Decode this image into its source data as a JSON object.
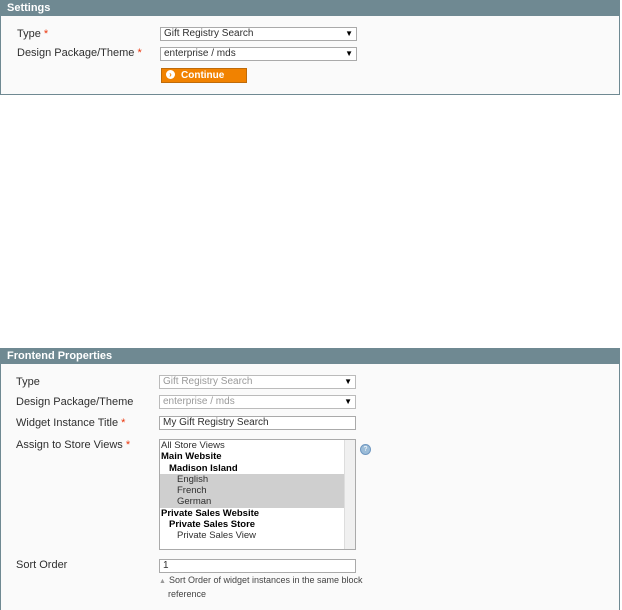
{
  "settings": {
    "title": "Settings",
    "type_label": "Type",
    "type_value": "Gift Registry Search",
    "theme_label": "Design Package/Theme",
    "theme_value": "enterprise / mds",
    "required_mark": "*",
    "continue_label": "Continue",
    "continue_icon": "chevron-right-icon",
    "dropdown_icon": "triangle-down"
  },
  "frontend": {
    "title": "Frontend Properties",
    "type_label": "Type",
    "type_value": "Gift Registry Search",
    "theme_label": "Design Package/Theme",
    "theme_value": "enterprise / mds",
    "instance_title_label": "Widget Instance Title",
    "instance_title_value": "My Gift Registry Search",
    "store_views_label": "Assign to Store Views",
    "store_views": [
      {
        "label": "All Store Views",
        "level": 1,
        "group": false,
        "selected": false
      },
      {
        "label": "Main Website",
        "level": 1,
        "group": true,
        "selected": false
      },
      {
        "label": "Madison Island",
        "level": 2,
        "group": true,
        "selected": false
      },
      {
        "label": "English",
        "level": 3,
        "group": false,
        "selected": true
      },
      {
        "label": "French",
        "level": 3,
        "group": false,
        "selected": true
      },
      {
        "label": "German",
        "level": 3,
        "group": false,
        "selected": true
      },
      {
        "label": "Private Sales Website",
        "level": 1,
        "group": true,
        "selected": false
      },
      {
        "label": "Private Sales Store",
        "level": 2,
        "group": true,
        "selected": false
      },
      {
        "label": "Private Sales View",
        "level": 3,
        "group": false,
        "selected": false
      }
    ],
    "help_icon": "question-icon",
    "sort_order_label": "Sort Order",
    "sort_order_value": "1",
    "sort_order_note_line1": "Sort Order of widget instances in the same block",
    "sort_order_note_line2": "reference",
    "required_mark": "*"
  },
  "colors": {
    "header_bg": "#6f8992",
    "button_bg": "#f18200",
    "required": "#eb340a",
    "selected_option": "#cfcfcf"
  }
}
